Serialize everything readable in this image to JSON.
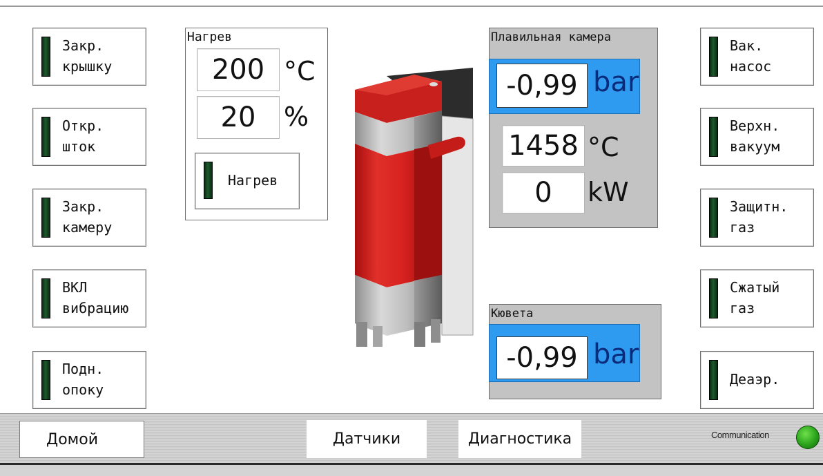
{
  "left_buttons": [
    {
      "label": "Закр.\nкрышку"
    },
    {
      "label": "Откр.\nшток"
    },
    {
      "label": "Закр.\nкамеру"
    },
    {
      "label": "ВКЛ\nвибрацию"
    },
    {
      "label": "Подн.\nопоку"
    }
  ],
  "right_buttons": [
    {
      "label": "Вак.\nнасос"
    },
    {
      "label": "Верхн.\nвакуум"
    },
    {
      "label": "Защитн.\nгаз"
    },
    {
      "label": "Сжатый\nгаз"
    },
    {
      "label": "Деаэр."
    }
  ],
  "heating": {
    "title": "Нагрев",
    "temperature": "200",
    "temperature_unit": "°C",
    "power": "20",
    "power_unit": "%",
    "button_label": "Нагрев"
  },
  "melting_chamber": {
    "title": "Плавильная камера",
    "pressure": "-0,99",
    "pressure_unit": "bar",
    "temperature": "1458",
    "temperature_unit": "°C",
    "power": "0",
    "power_unit": "kW"
  },
  "cuvette": {
    "title": "Кювета",
    "pressure": "-0,99",
    "pressure_unit": "bar"
  },
  "nav": {
    "home": "Домой",
    "sensors": "Датчики",
    "diagnostics": "Диагностика"
  },
  "status": {
    "communication_label": "Communication",
    "communication_color": "#2aa21c"
  },
  "colors": {
    "accent_blue": "#2f9bf0",
    "machine_red": "#d8221f",
    "led_dark_green": "#1d5a2c"
  }
}
